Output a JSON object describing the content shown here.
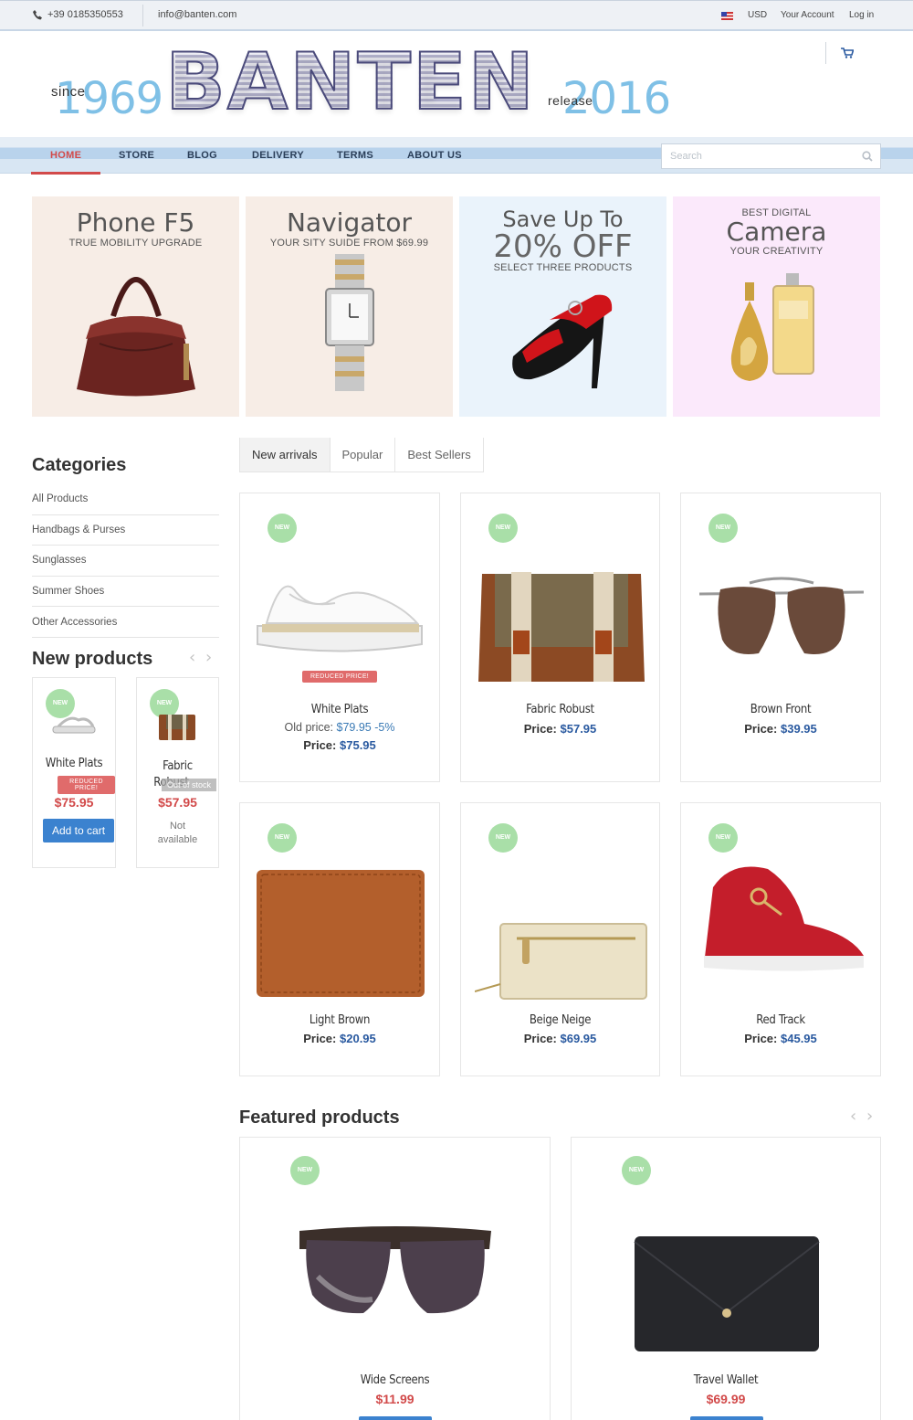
{
  "topbar": {
    "phone": "+39  0185350553",
    "email": "info@banten.com",
    "currency": "USD",
    "account": "Your Account",
    "login": "Log in"
  },
  "header": {
    "since_word": "since",
    "since_year": "1969",
    "logo": "BANTEN",
    "release_word": "release",
    "release_year": "2016"
  },
  "nav": {
    "items": [
      "HOME",
      "STORE",
      "BLOG",
      "DELIVERY",
      "TERMS",
      "ABOUT US"
    ],
    "search_placeholder": "Search"
  },
  "banners": [
    {
      "title": "Phone F5",
      "subtitle": "TRUE MOBILITY UPGRADE",
      "bg": "#f7ede6"
    },
    {
      "title": "Navigator",
      "subtitle": "YOUR SITY SUIDE FROM $69.99",
      "bg": "#f7ede6"
    },
    {
      "title_line1": "Save Up To",
      "title_line2": "20% OFF",
      "subtitle": "SELECT THREE PRODUCTS",
      "bg": "#eaf3fb"
    },
    {
      "pre": "BEST DIGITAL",
      "title": "Camera",
      "subtitle": "YOUR CREATIVITY",
      "bg": "#fbe9fb"
    }
  ],
  "sidebar": {
    "categories_title": "Categories",
    "categories": [
      "All Products",
      "Handbags & Purses",
      "Sunglasses",
      "Summer Shoes",
      "Other Accessories"
    ],
    "new_products_title": "New products",
    "new_products": [
      {
        "badge": "NEW",
        "name": "White Plats",
        "label": "REDUCED PRICE!",
        "price": "$75.95",
        "button": "Add to cart"
      },
      {
        "badge": "NEW",
        "name_line1": "Fabric",
        "name_line2": "Robust",
        "label": "Out of stock",
        "price": "$57.95",
        "status": "Not available"
      }
    ]
  },
  "tabs": [
    "New arrivals",
    "Popular",
    "Best Sellers"
  ],
  "products": [
    {
      "badge": "NEW",
      "name": "White Plats",
      "label": "REDUCED PRICE!",
      "old_price_label": "Old price:",
      "old_price": "$79.95 -5%",
      "price_label": "Price:",
      "price": "$75.95"
    },
    {
      "badge": "NEW",
      "name": "Fabric Robust",
      "price_label": "Price:",
      "price": "$57.95"
    },
    {
      "badge": "NEW",
      "name": "Brown Front",
      "price_label": "Price:",
      "price": "$39.95"
    },
    {
      "badge": "NEW",
      "name": "Light Brown",
      "price_label": "Price:",
      "price": "$20.95"
    },
    {
      "badge": "NEW",
      "name": "Beige Neige",
      "price_label": "Price:",
      "price": "$69.95"
    },
    {
      "badge": "NEW",
      "name": "Red Track",
      "price_label": "Price:",
      "price": "$45.95"
    }
  ],
  "featured": {
    "title": "Featured products",
    "items": [
      {
        "badge": "NEW",
        "name": "Wide Screens",
        "price": "$11.99"
      },
      {
        "badge": "NEW",
        "name": "Travel Wallet",
        "price": "$69.99"
      }
    ]
  },
  "colors": {
    "accent_red": "#d24a4a",
    "price_blue": "#2a5aa0",
    "badge_green": "#a9dfa8",
    "button_blue": "#3b82cf",
    "year_blue": "#7fc0e6"
  }
}
